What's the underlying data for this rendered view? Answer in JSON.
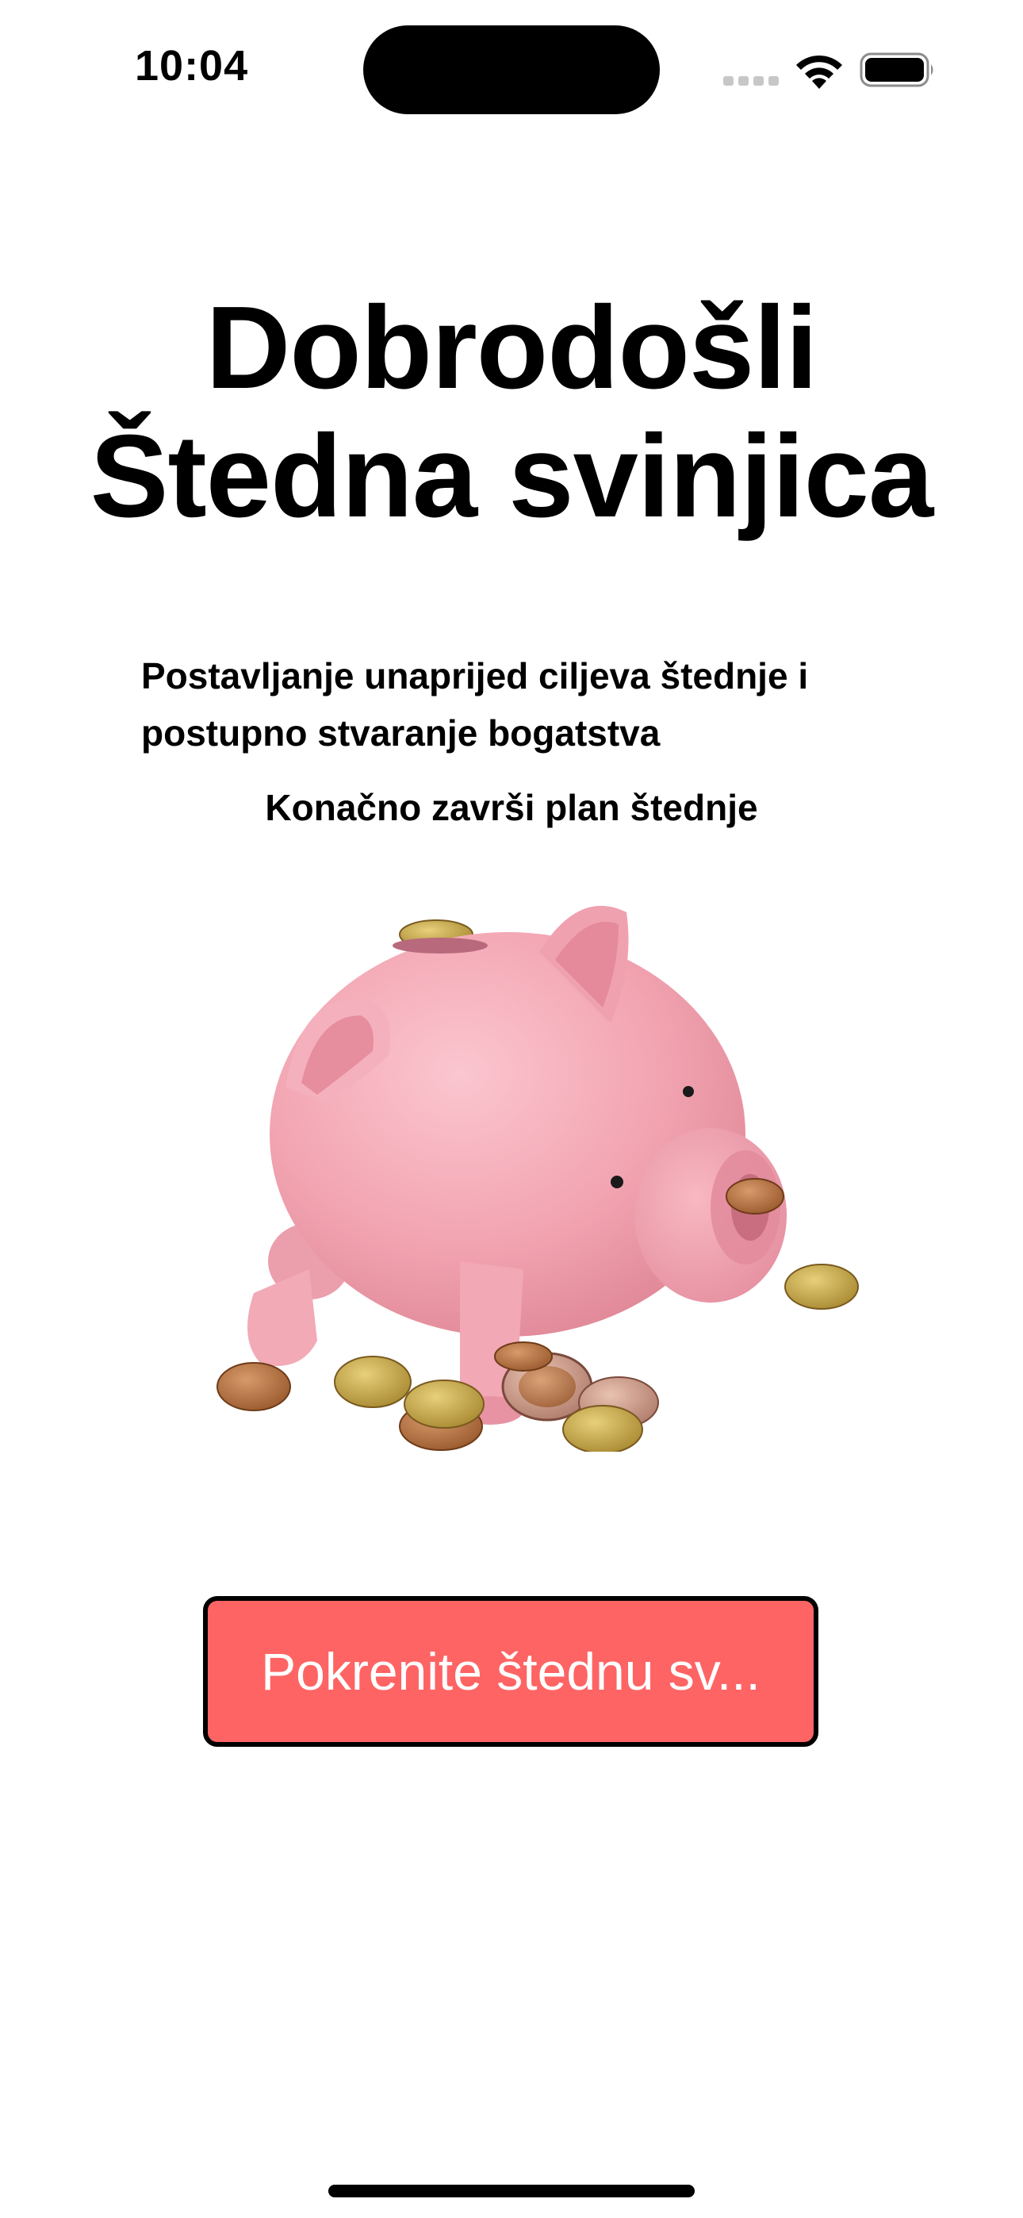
{
  "status_bar": {
    "time": "10:04",
    "signal_icon": "cellular-signal-icon",
    "wifi_icon": "wifi-icon",
    "battery_icon": "battery-icon",
    "battery_level": 1.0
  },
  "welcome": {
    "title_line1": "Dobrodošli",
    "title_line2": "Štedna svinjica",
    "subtitle_line1": "Postavljanje unaprijed ciljeva štednje i",
    "subtitle_line2": "postupno stvaranje bogatstva",
    "tagline": "Konačno završi plan štednje"
  },
  "illustration": {
    "icon": "piggy-bank-icon"
  },
  "actions": {
    "start_label": "Pokrenite štednu sv...",
    "button_color": "#fe6464"
  }
}
